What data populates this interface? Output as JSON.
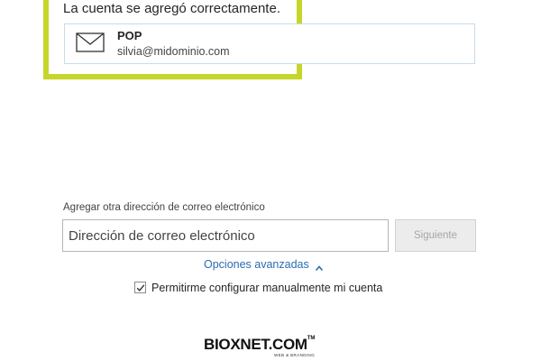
{
  "success": {
    "message": "La cuenta se agregó correctamente."
  },
  "account": {
    "icon": "mail-icon",
    "type": "POP",
    "email": "silvia@midominio.com"
  },
  "add_account": {
    "label": "Agregar otra dirección de correo electrónico",
    "input_value": "",
    "input_placeholder": "Dirección de correo electrónico",
    "next_label": "Siguiente"
  },
  "advanced": {
    "label": "Opciones avanzadas",
    "icon": "chevron-up-icon"
  },
  "manual_config": {
    "checked": true,
    "label": "Permitirme configurar manualmente mi cuenta"
  },
  "watermark": {
    "main": "BIOXNET.COM",
    "tm": "TM",
    "sub": "WEB & BRANDING"
  },
  "colors": {
    "highlight": "#c6d629",
    "link": "#2b6cb0",
    "card_border": "#c9dcea"
  }
}
